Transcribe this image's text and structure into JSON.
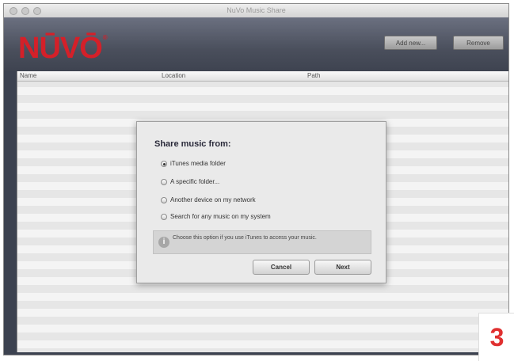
{
  "window": {
    "title": "NuVo Music Share"
  },
  "brand": {
    "logo_text": "NŪVŌ",
    "logo_color": "#d42029"
  },
  "toolbar": {
    "add_label": "Add new...",
    "remove_label": "Remove"
  },
  "table": {
    "columns": [
      "Name",
      "Location",
      "Path"
    ]
  },
  "dialog": {
    "title": "Share music from:",
    "options": [
      {
        "label": "iTunes media folder",
        "selected": true
      },
      {
        "label": "A specific folder...",
        "selected": false
      },
      {
        "label": "Another device on my network",
        "selected": false
      },
      {
        "label": "Search for any music on my system",
        "selected": false
      }
    ],
    "info_text": "Choose this option if you use iTunes to access your music.",
    "cancel_label": "Cancel",
    "next_label": "Next"
  },
  "step_badge": "3"
}
